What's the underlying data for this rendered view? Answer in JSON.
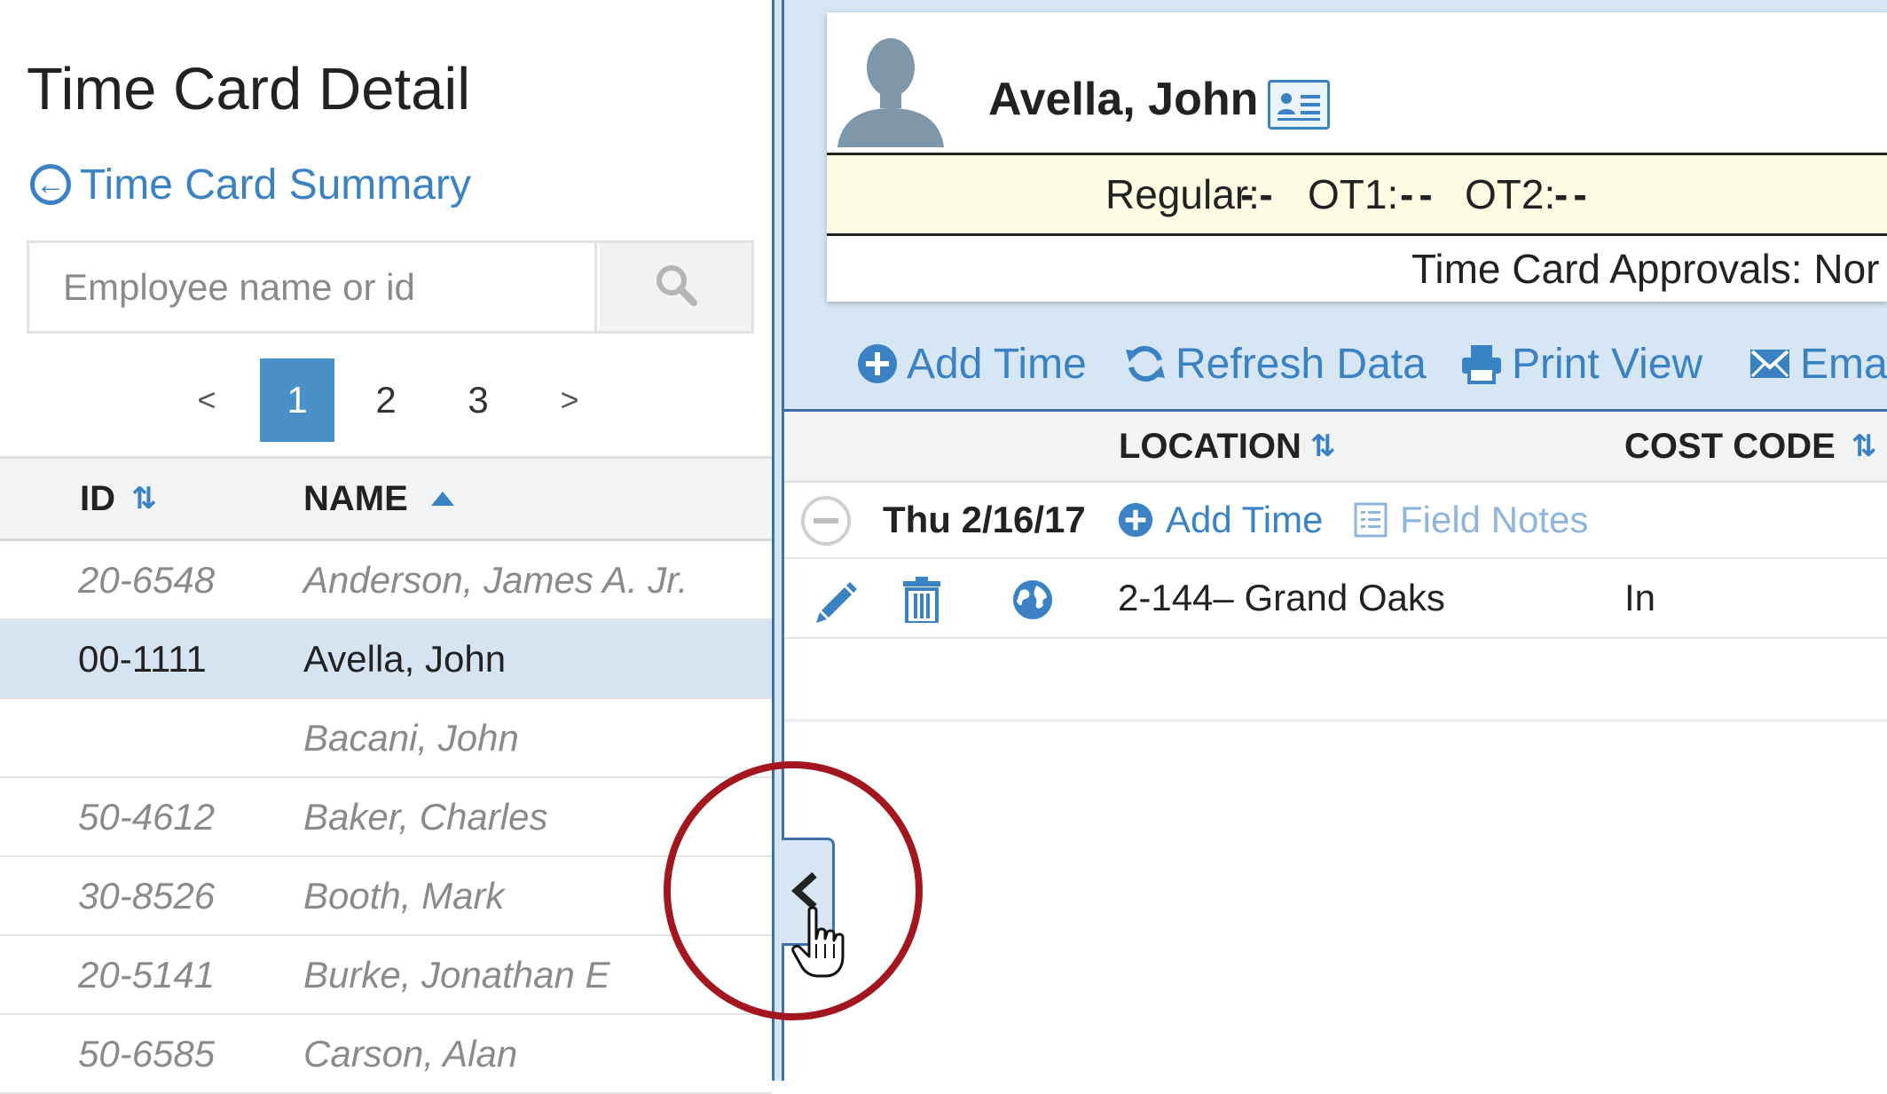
{
  "left_panel": {
    "title": "Time Card Detail",
    "back_link": "Time Card Summary",
    "search": {
      "placeholder": "Employee name or id",
      "value": ""
    },
    "pager": {
      "prev": "<",
      "pages": [
        "1",
        "2",
        "3"
      ],
      "next": ">",
      "active": "1"
    },
    "columns": {
      "id": "ID",
      "name": "NAME"
    },
    "rows": [
      {
        "id": "20-6548",
        "name": "Anderson, James A. Jr.",
        "selected": false
      },
      {
        "id": "00-1111",
        "name": "Avella, John",
        "selected": true
      },
      {
        "id": "",
        "name": "Bacani, John",
        "selected": false
      },
      {
        "id": "50-4612",
        "name": "Baker, Charles",
        "selected": false
      },
      {
        "id": "30-8526",
        "name": "Booth, Mark",
        "selected": false
      },
      {
        "id": "20-5141",
        "name": "Burke, Jonathan E",
        "selected": false
      },
      {
        "id": "50-6585",
        "name": "Carson, Alan",
        "selected": false
      }
    ]
  },
  "employee": {
    "name": "Avella, John",
    "hours": {
      "regular_label": "Regular:",
      "regular_value": "--",
      "ot1_label": "OT1:",
      "ot1_value": "--",
      "ot2_label": "OT2:",
      "ot2_value": "--"
    },
    "approvals": "Time Card Approvals: Nor"
  },
  "toolbar": {
    "add_time": "Add Time",
    "refresh": "Refresh Data",
    "print": "Print View",
    "email": "Emai"
  },
  "grid": {
    "columns": {
      "location": "LOCATION",
      "cost_code": "COST CODE"
    },
    "day": {
      "date": "Thu 2/16/17",
      "add_time": "Add Time",
      "field_notes": "Field Notes"
    },
    "entries": [
      {
        "location": "2-144– Grand Oaks",
        "cost_code": "In"
      }
    ]
  },
  "colors": {
    "accent": "#3a82c4",
    "selected_row": "#d6e3f1",
    "panel_bg": "#d7e6f5",
    "hours_bar": "#fdfde3",
    "highlight_ring": "#a3151f"
  },
  "icons": [
    "back-circle-icon",
    "search-icon",
    "avatar-icon",
    "id-card-icon",
    "plus-circle-icon",
    "refresh-icon",
    "printer-icon",
    "envelope-icon",
    "sort-icon",
    "sort-up-icon",
    "collapse-icon",
    "notes-icon",
    "pencil-icon",
    "trash-icon",
    "globe-icon",
    "chevron-left-icon",
    "hand-cursor-icon"
  ]
}
